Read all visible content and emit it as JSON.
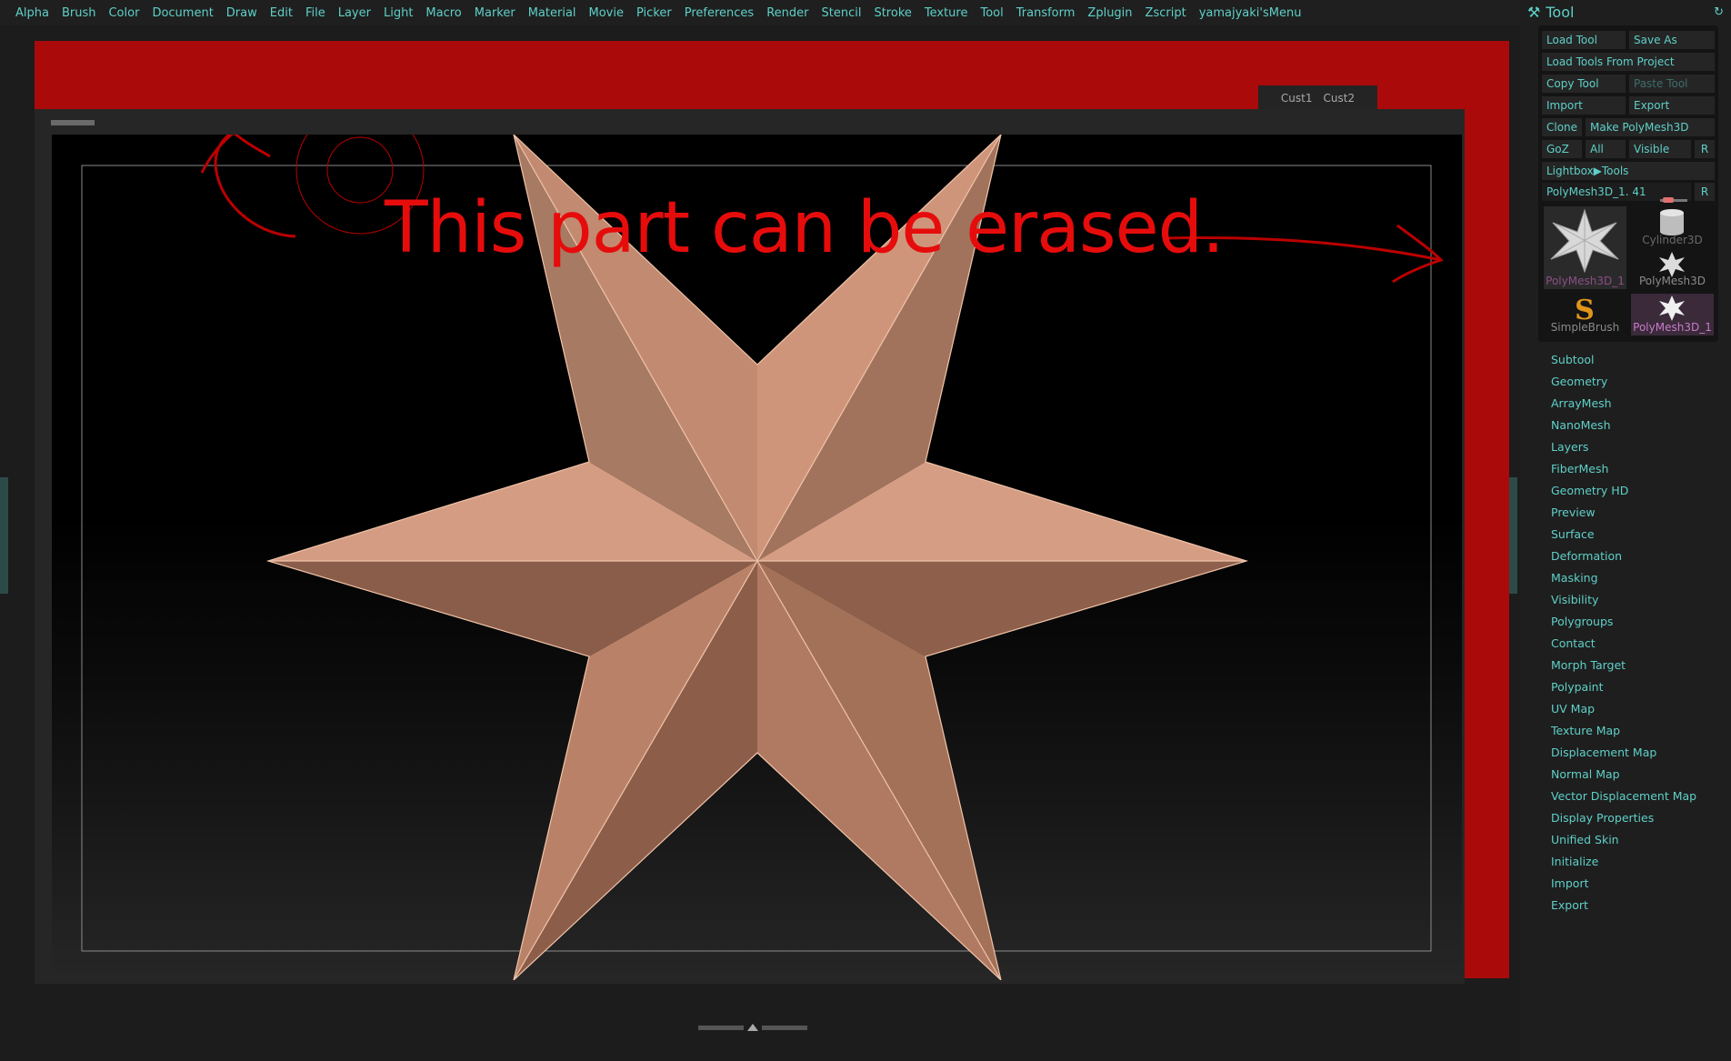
{
  "menubar": {
    "items": [
      "Alpha",
      "Brush",
      "Color",
      "Document",
      "Draw",
      "Edit",
      "File",
      "Layer",
      "Light",
      "Macro",
      "Marker",
      "Material",
      "Movie",
      "Picker",
      "Preferences",
      "Render",
      "Stencil",
      "Stroke",
      "Texture",
      "Tool",
      "Transform",
      "Zplugin",
      "Zscript",
      "yamajyaki'sMenu"
    ]
  },
  "canvas": {
    "custom_tabs": [
      "Cust1",
      "Cust2"
    ],
    "annotation_text": "This part can be erased.",
    "annotation_color": "#e60c0c",
    "star_color": "#c8866c"
  },
  "tool_panel": {
    "title": "Tool",
    "buttons": {
      "load_tool": "Load Tool",
      "save_as": "Save As",
      "load_from_project": "Load Tools From Project",
      "copy_tool": "Copy Tool",
      "paste_tool": "Paste Tool",
      "import": "Import",
      "export": "Export",
      "clone": "Clone",
      "make_polymesh": "Make PolyMesh3D",
      "goz": "GoZ",
      "all": "All",
      "visible": "Visible",
      "r": "R",
      "lightbox_tools": "Lightbox▶Tools"
    },
    "current_tool": "PolyMesh3D_1. 41",
    "current_tool_r": "R",
    "thumbnails": [
      {
        "label": "PolyMesh3D_1",
        "icon": "star-icon"
      },
      {
        "label": "Cylinder3D",
        "icon": "cylinder-icon"
      },
      {
        "label": "PolyMesh3D",
        "icon": "star-icon"
      },
      {
        "label": "SimpleBrush",
        "icon": "simplebrush-icon"
      },
      {
        "label": "PolyMesh3D_1",
        "icon": "star-icon"
      }
    ],
    "sections": [
      "Subtool",
      "Geometry",
      "ArrayMesh",
      "NanoMesh",
      "Layers",
      "FiberMesh",
      "Geometry HD",
      "Preview",
      "Surface",
      "Deformation",
      "Masking",
      "Visibility",
      "Polygroups",
      "Contact",
      "Morph Target",
      "Polypaint",
      "UV Map",
      "Texture Map",
      "Displacement Map",
      "Normal Map",
      "Vector Displacement Map",
      "Display Properties",
      "Unified Skin",
      "Initialize",
      "Import",
      "Export"
    ]
  }
}
